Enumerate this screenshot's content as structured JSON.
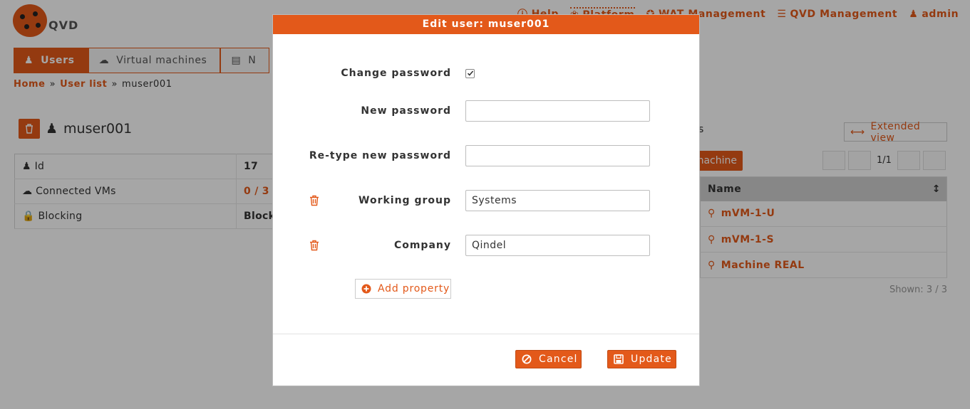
{
  "app": {
    "logo_text": "QVD"
  },
  "top_menu": [
    {
      "label": "Help",
      "icon": "help-icon"
    },
    {
      "label": "Platform",
      "icon": "bug-icon"
    },
    {
      "label": "WAT Management",
      "icon": "wrench-icon"
    },
    {
      "label": "QVD Management",
      "icon": "sliders-icon"
    },
    {
      "label": "admin",
      "icon": "user-icon"
    }
  ],
  "tabs": [
    {
      "label": "Users",
      "icon": "users-icon",
      "active": true
    },
    {
      "label": "Virtual machines",
      "icon": "cloud-icon",
      "active": false
    },
    {
      "label": "N",
      "icon": "hdd-icon",
      "active": false
    }
  ],
  "breadcrumb": {
    "home": "Home",
    "list": "User list",
    "current": "muser001"
  },
  "detail": {
    "title": "muser001",
    "rows": [
      {
        "key": "Id",
        "value": "17"
      },
      {
        "key": "Connected VMs",
        "value": "0 / 3"
      },
      {
        "key": "Blocking",
        "value": "Block"
      }
    ]
  },
  "vm_panel": {
    "title_fragment": "s",
    "extended_view": "Extended view",
    "new_vm_fragment": "machine",
    "pagination": "1/1",
    "column_name": "Name",
    "rows": [
      "mVM-1-U",
      "mVM-1-S",
      "Machine REAL"
    ],
    "shown": "Shown: 3 / 3"
  },
  "modal": {
    "title": "Edit user: muser001",
    "change_password_label": "Change password",
    "change_password_checked": true,
    "new_password_label": "New password",
    "new_password_value": "",
    "retype_password_label": "Re-type new password",
    "retype_password_value": "",
    "properties": [
      {
        "label": "Working group",
        "value": "Systems"
      },
      {
        "label": "Company",
        "value": "Qindel"
      }
    ],
    "add_property": "Add property",
    "cancel": "Cancel",
    "update": "Update"
  },
  "colors": {
    "accent": "#e3591a",
    "overlay": "rgba(0,0,0,0.35)"
  }
}
